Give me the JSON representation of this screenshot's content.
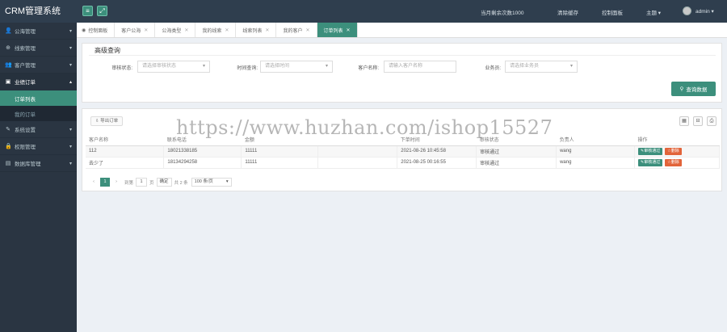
{
  "brand": "CRM管理系统",
  "sidebar": {
    "items": [
      {
        "icon": "user-icon",
        "glyph": "👤",
        "label": "公海管理"
      },
      {
        "icon": "globe-icon",
        "glyph": "⊕",
        "label": "线索管理"
      },
      {
        "icon": "users-icon",
        "glyph": "👥",
        "label": "客户管理"
      },
      {
        "icon": "briefcase-icon",
        "glyph": "▣",
        "label": "业绩订单",
        "open": true
      },
      {
        "icon": "wrench-icon",
        "glyph": "✎",
        "label": "系统设置"
      },
      {
        "icon": "lock-icon",
        "glyph": "🔒",
        "label": "权限管理"
      },
      {
        "icon": "database-icon",
        "glyph": "▤",
        "label": "数据库管理"
      }
    ],
    "subitems": [
      "订单列表",
      "我的订单"
    ]
  },
  "header": {
    "menu_icon": "≡",
    "expand_icon": "⤢",
    "remaining": "当月剩余次数1000",
    "clear_cache": "清除缓存",
    "control_panel": "控制面板",
    "theme": "主题 ▾",
    "user": "admin ▾"
  },
  "tabs": [
    {
      "label": "控制面板",
      "home": true
    },
    {
      "label": "客户公海"
    },
    {
      "label": "公海类型"
    },
    {
      "label": "我的线索"
    },
    {
      "label": "线索列表"
    },
    {
      "label": "我的客户"
    },
    {
      "label": "订单列表",
      "active": true
    }
  ],
  "query": {
    "title": "高级查询",
    "filters": [
      {
        "label": "审核状态:",
        "placeholder": "请选择审核状态",
        "dropdown": true
      },
      {
        "label": "时间查询:",
        "placeholder": "请选择时间",
        "dropdown": true
      },
      {
        "label": "客户名称:",
        "placeholder": "请输入客户名称",
        "dropdown": false
      },
      {
        "label": "业务员:",
        "placeholder": "请选择业务员",
        "dropdown": true
      }
    ],
    "search_label": "查询数据"
  },
  "table": {
    "export_label": "导出订单",
    "toolbar": [
      "▦",
      "⊟",
      "⎙"
    ],
    "columns": [
      "客户名称",
      "联系电话",
      "金额",
      "",
      "下单时间",
      "审核状态",
      "负责人",
      "操作"
    ],
    "rows": [
      {
        "cells": [
          "112",
          "18021338185",
          "11111",
          "",
          "2021-08-26 10:45:58",
          "审核通过",
          "wang"
        ],
        "actions": [
          "✎审核通过",
          "☆删除"
        ]
      },
      {
        "cells": [
          "去少了",
          "18134294258",
          "11111",
          "",
          "2021-08-25 00:16:55",
          "审核通过",
          "wang"
        ],
        "actions": [
          "✎审核通过",
          "☆删除"
        ]
      }
    ]
  },
  "pager": {
    "prev": "‹",
    "current": "1",
    "next": "›",
    "goto_label": "到第",
    "goto_value": "1",
    "page_unit": "页",
    "confirm": "确定",
    "total": "共 2 条",
    "per_page": "100 条/页"
  },
  "watermark": "https://www.huzhan.com/ishop15527"
}
